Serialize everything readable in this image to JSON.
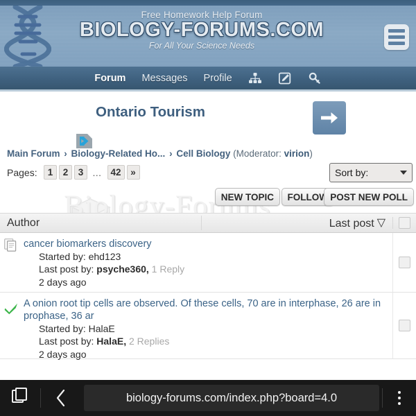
{
  "header": {
    "tagline_top": "Free Homework Help Forum",
    "wordmark": "BIOLOGY-FORUMS.COM",
    "tagline_bottom": "For All Your Science Needs",
    "logo_icon": "dna-helix-icon",
    "menu_icon": "hamburger-menu-icon",
    "bg_color": "#86a7c4"
  },
  "nav": {
    "items": [
      {
        "label": "Forum",
        "active": true
      },
      {
        "label": "Messages",
        "active": false
      },
      {
        "label": "Profile",
        "active": false
      }
    ],
    "icons": [
      {
        "name": "sitemap-icon"
      },
      {
        "name": "compose-edit-icon"
      },
      {
        "name": "key-login-icon"
      }
    ],
    "bg_color": "#3f617f"
  },
  "ad": {
    "title": "Ontario Tourism",
    "arrow_icon": "arrow-right-icon",
    "adchoices_icon": "adchoices-icon"
  },
  "breadcrumb": {
    "items": [
      "Main Forum",
      "Biology-Related Ho...",
      "Cell Biology"
    ],
    "separator": "›",
    "moderator_label": "(Moderator:",
    "moderator_name": "virion",
    "moderator_close": ")"
  },
  "watermark": {
    "text": "Biology-Forums"
  },
  "pagination": {
    "label": "Pages:",
    "pages": [
      "1",
      "2",
      "3",
      "…",
      "42",
      "»"
    ]
  },
  "sort": {
    "label": "Sort by:"
  },
  "actions": {
    "new_topic": "NEW TOPIC",
    "follow": "FOLLOW",
    "post_new_poll": "POST NEW POLL"
  },
  "table": {
    "col_author": "Author",
    "col_lastpost": "Last post",
    "sort_indicator": "▽",
    "rows": [
      {
        "status_icon": "pages-document-icon",
        "title": "cancer biomarkers discovery",
        "started_by_label": "Started by:",
        "started_by": "ehd123",
        "last_post_label": "Last post by:",
        "last_post_by": "psyche360,",
        "replies": "1 Reply",
        "time": "2 days ago"
      },
      {
        "status_icon": "green-check-icon",
        "title": "A onion root tip cells are observed. Of these cells, 70 are in interphase, 26 are in prophase, 36 ar",
        "started_by_label": "Started by:",
        "started_by": "HalaE",
        "last_post_label": "Last post by:",
        "last_post_by": "HalaE,",
        "replies": "2 Replies",
        "time": "2 days ago"
      }
    ]
  },
  "browser": {
    "tabs_icon": "tab-switcher-icon",
    "back_icon": "chevron-left-icon",
    "url": "biology-forums.com/index.php?board=4.0",
    "menu_icon": "overflow-menu-icon",
    "bar_color": "#181818"
  }
}
